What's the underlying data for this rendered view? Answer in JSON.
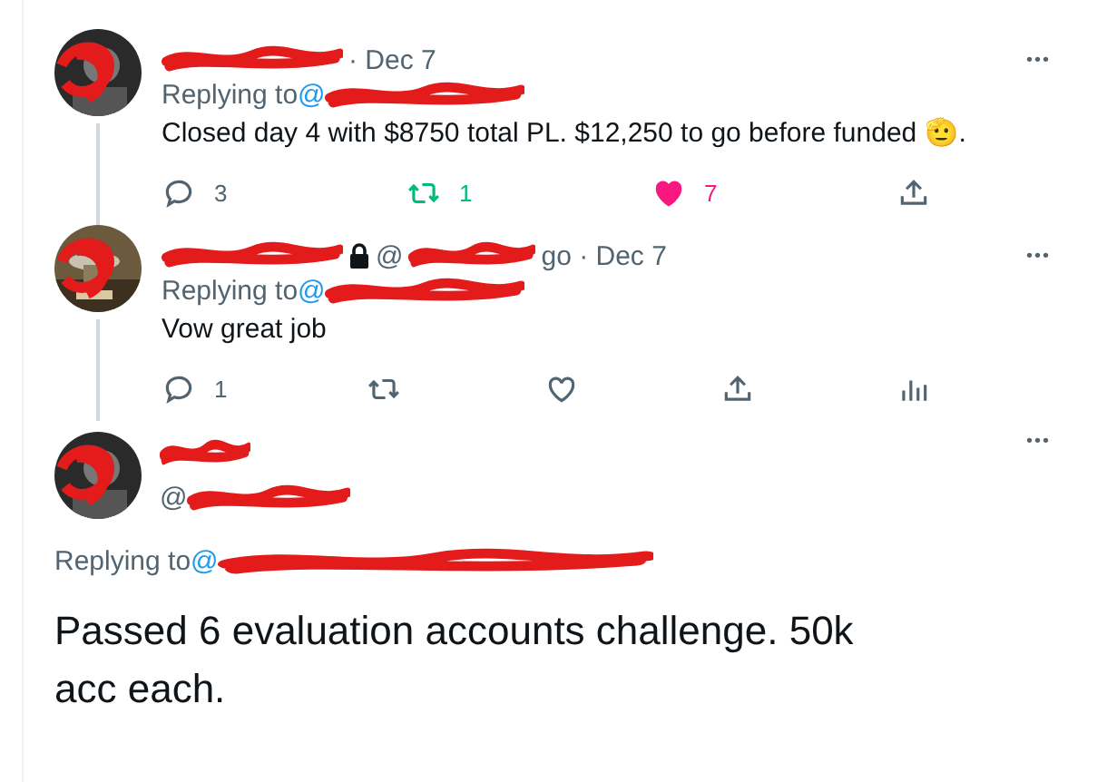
{
  "tweets": [
    {
      "kind": "reply",
      "author": {
        "locked": false,
        "time": "· Dec 7"
      },
      "more": "•••",
      "replying_label": "Replying to",
      "replying_handle": "@",
      "text": "Closed day 4 with $8750 total PL. $12,250 to go before funded 🫡.",
      "thread_line": true,
      "actions": [
        {
          "kind": "reply",
          "count": "3"
        },
        {
          "kind": "retweet",
          "count": "1",
          "on": true
        },
        {
          "kind": "like",
          "count": "7",
          "on": true
        },
        {
          "kind": "share"
        }
      ]
    },
    {
      "kind": "reply",
      "author": {
        "locked": true,
        "handle": "@",
        "time": "go · Dec 7"
      },
      "more": "•••",
      "replying_label": "Replying to",
      "replying_handle": "@",
      "text": "Vow great job",
      "thread_line": true,
      "actions": [
        {
          "kind": "reply",
          "count": "1"
        },
        {
          "kind": "retweet",
          "on": false
        },
        {
          "kind": "like",
          "on": false
        },
        {
          "kind": "share"
        },
        {
          "kind": "analytics"
        }
      ]
    },
    {
      "kind": "focus",
      "author": {
        "locked": false,
        "handle": "@"
      },
      "more": "•••",
      "replying_label": "Replying to",
      "replying_handle": "@",
      "text": "Passed 6 evaluation accounts challenge. 50k acc each.",
      "thread_line": false
    }
  ]
}
